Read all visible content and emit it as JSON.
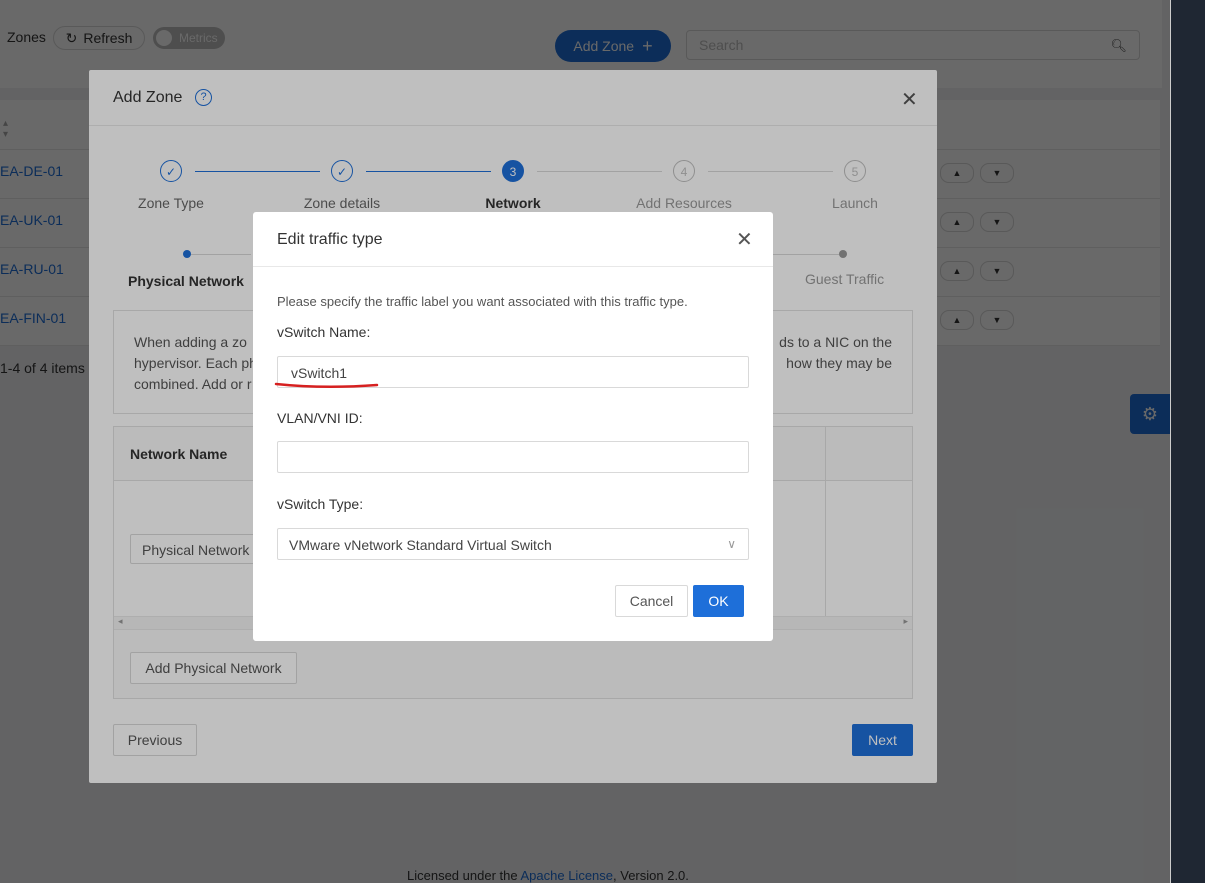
{
  "topbar": {
    "zones_label": "Zones",
    "refresh_label": "Refresh",
    "metrics_label": "Metrics",
    "add_zone_label": "Add Zone",
    "search_placeholder": "Search"
  },
  "zones_table": {
    "rows": [
      {
        "name": "EA-DE-01"
      },
      {
        "name": "EA-UK-01"
      },
      {
        "name": "EA-RU-01"
      },
      {
        "name": "EA-FIN-01"
      }
    ],
    "pagination_text": "1-4 of 4 items"
  },
  "footer": {
    "prefix": "Licensed under the",
    "link": "Apache License",
    "suffix": ", Version 2.0."
  },
  "add_zone_modal": {
    "title": "Add Zone",
    "steps": [
      {
        "label": "Zone Type",
        "status": "done",
        "number": ""
      },
      {
        "label": "Zone details",
        "status": "done",
        "number": ""
      },
      {
        "label": "Network",
        "status": "active",
        "number": "3"
      },
      {
        "label": "Add Resources",
        "status": "pending",
        "number": "4"
      },
      {
        "label": "Launch",
        "status": "pending",
        "number": "5"
      }
    ],
    "substeps": {
      "first": "Physical Network",
      "last": "Guest Traffic"
    },
    "info": {
      "line1_left": "When adding a zo",
      "line1_right": "ds to a NIC on the",
      "line2_left": "hypervisor. Each ph",
      "line2_right": "how they may be",
      "line3_left": "combined. Add or r"
    },
    "table_header": "Network Name",
    "physical_network_value": "Physical Network",
    "add_physical_network_label": "Add Physical Network",
    "previous_label": "Previous",
    "next_label": "Next"
  },
  "edit_traffic_modal": {
    "title": "Edit traffic type",
    "description": "Please specify the traffic label you want associated with this traffic type.",
    "vswitch_name_label": "vSwitch Name:",
    "vswitch_name_value": "vSwitch1",
    "vlan_label": "VLAN/VNI ID:",
    "vlan_value": "",
    "vswitch_type_label": "vSwitch Type:",
    "vswitch_type_value": "VMware vNetwork Standard Virtual Switch",
    "cancel_label": "Cancel",
    "ok_label": "OK"
  },
  "colors": {
    "primary": "#1e6fd9",
    "annotation_underline": "#d62020"
  }
}
